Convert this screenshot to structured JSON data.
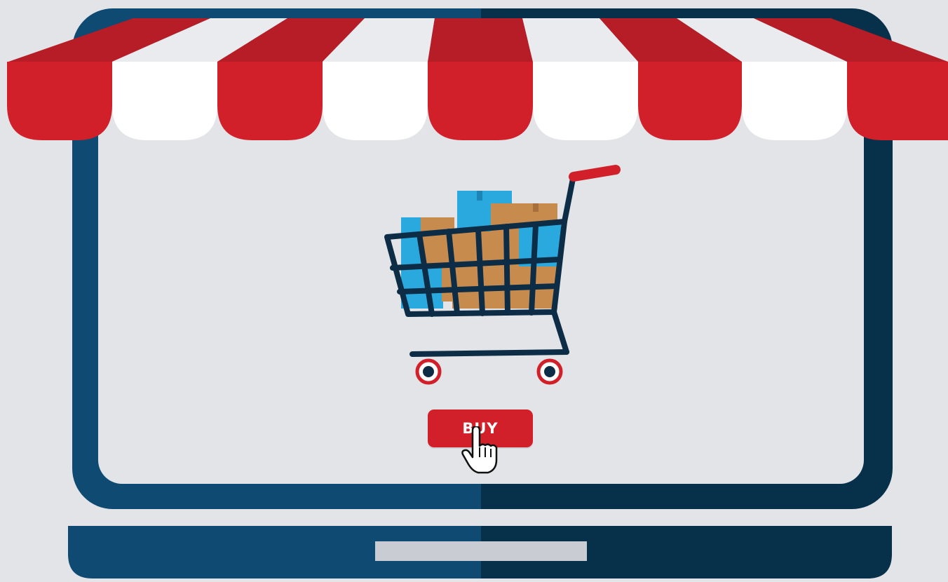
{
  "buy_button": {
    "label": "BUY"
  },
  "icons": {
    "laptop": "laptop-icon",
    "awning": "awning-icon",
    "cart": "shopping-cart-icon",
    "pointer": "hand-pointer-icon",
    "trackpad": "trackpad-icon"
  },
  "colors": {
    "background": "#e2e4e8",
    "frame_light": "#0e4a72",
    "frame_dark": "#07304a",
    "screen": "#e2e4e8",
    "awning_red": "#d2202a",
    "awning_red_dark": "#b61d26",
    "awning_white": "#ffffff",
    "box_brown": "#c78b4e",
    "box_blue": "#2aa9df",
    "trackpad": "#c9ccd2"
  }
}
